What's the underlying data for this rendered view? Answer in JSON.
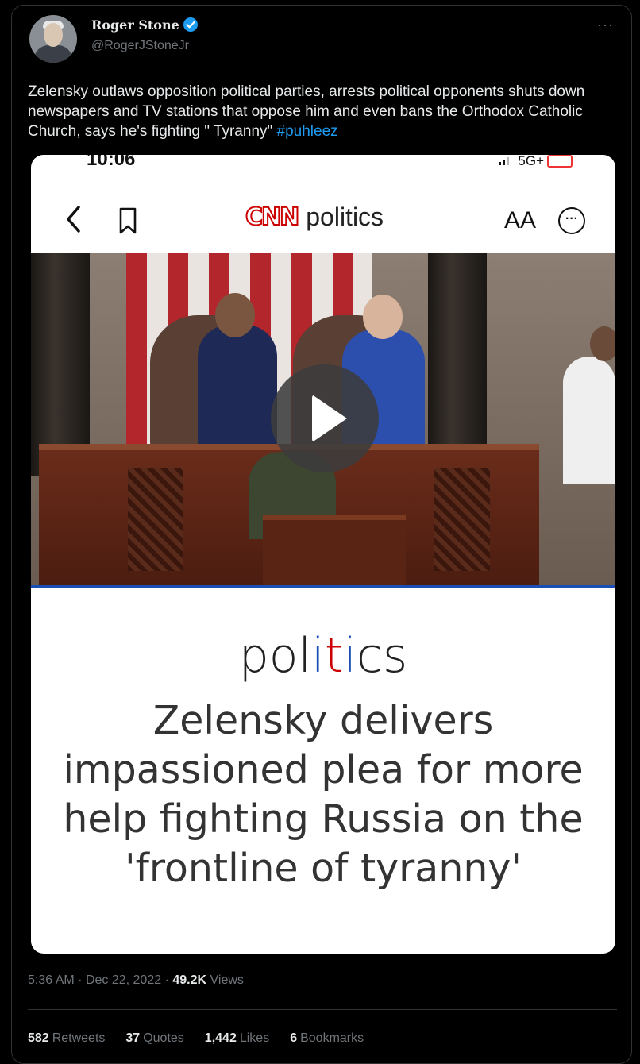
{
  "author": {
    "name": "Roger Stone",
    "handle": "@RogerJStoneJr",
    "verified": true
  },
  "tweet": {
    "text": "Zelensky outlaws opposition political parties, arrests political opponents shuts down newspapers and TV stations that oppose him and even bans the Orthodox Catholic Church, says he's fighting \" Tyranny\" ",
    "hashtag": "#puhleez"
  },
  "media": {
    "status_time": "10:06",
    "network": "5G+",
    "logo_brand": "CNN",
    "logo_section": "politics",
    "text_size_label": "AA",
    "section_word": "politics",
    "headline": "Zelensky delivers impassioned plea for more help fighting Russia on the 'frontline of tyranny'"
  },
  "meta": {
    "time": "5:36 AM",
    "separator": "·",
    "date": "Dec 22, 2022",
    "views_count": "49.2K",
    "views_label": "Views"
  },
  "stats": {
    "retweets_count": "582",
    "retweets_label": "Retweets",
    "quotes_count": "37",
    "quotes_label": "Quotes",
    "likes_count": "1,442",
    "likes_label": "Likes",
    "bookmarks_count": "6",
    "bookmarks_label": "Bookmarks"
  },
  "colors": {
    "link": "#1d9bf0",
    "verified": "#1d9bf0",
    "cnn_red": "#cc0000",
    "muted": "#71767b"
  }
}
